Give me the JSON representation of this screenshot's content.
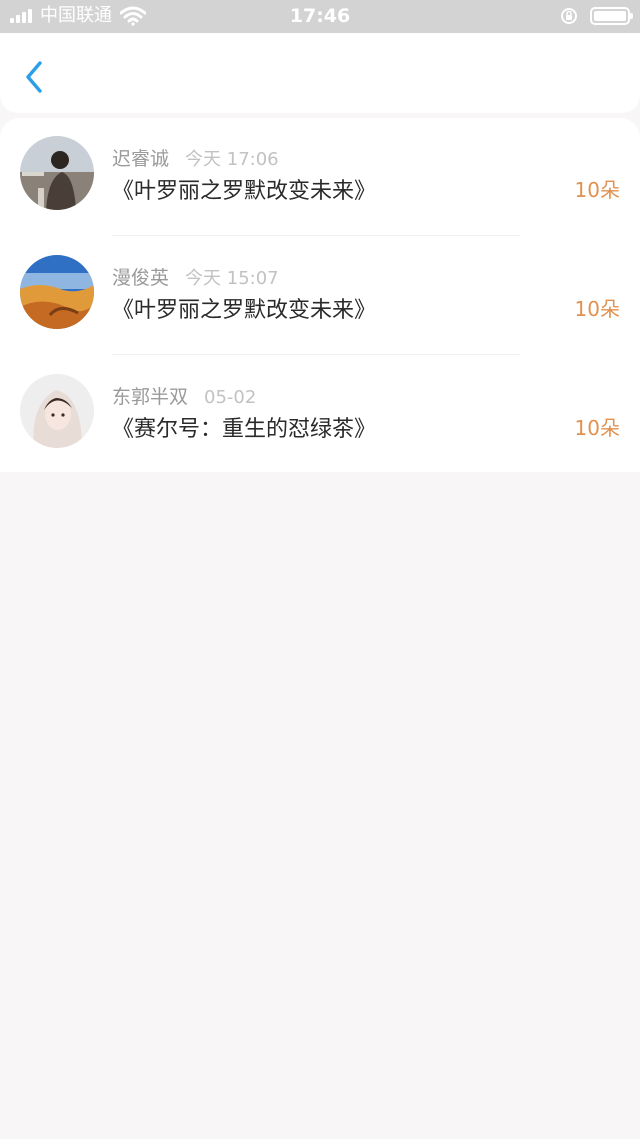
{
  "status_bar": {
    "carrier": "中国联通",
    "time": "17:46"
  },
  "header": {
    "back_icon": "chevron-left-icon",
    "accent_color": "#2a9ee8"
  },
  "gifts": [
    {
      "name": "迟睿诚",
      "time": "今天 17:06",
      "title": "《叶罗丽之罗默改变未来》",
      "amount": "10朵"
    },
    {
      "name": "漫俊英",
      "time": "今天 15:07",
      "title": "《叶罗丽之罗默改变未来》",
      "amount": "10朵"
    },
    {
      "name": "东郭半双",
      "time": "05-02",
      "title": "《赛尔号：重生的怼绿茶》",
      "amount": "10朵"
    }
  ],
  "colors": {
    "amount": "#e0914f",
    "background": "#f8f6f7"
  }
}
